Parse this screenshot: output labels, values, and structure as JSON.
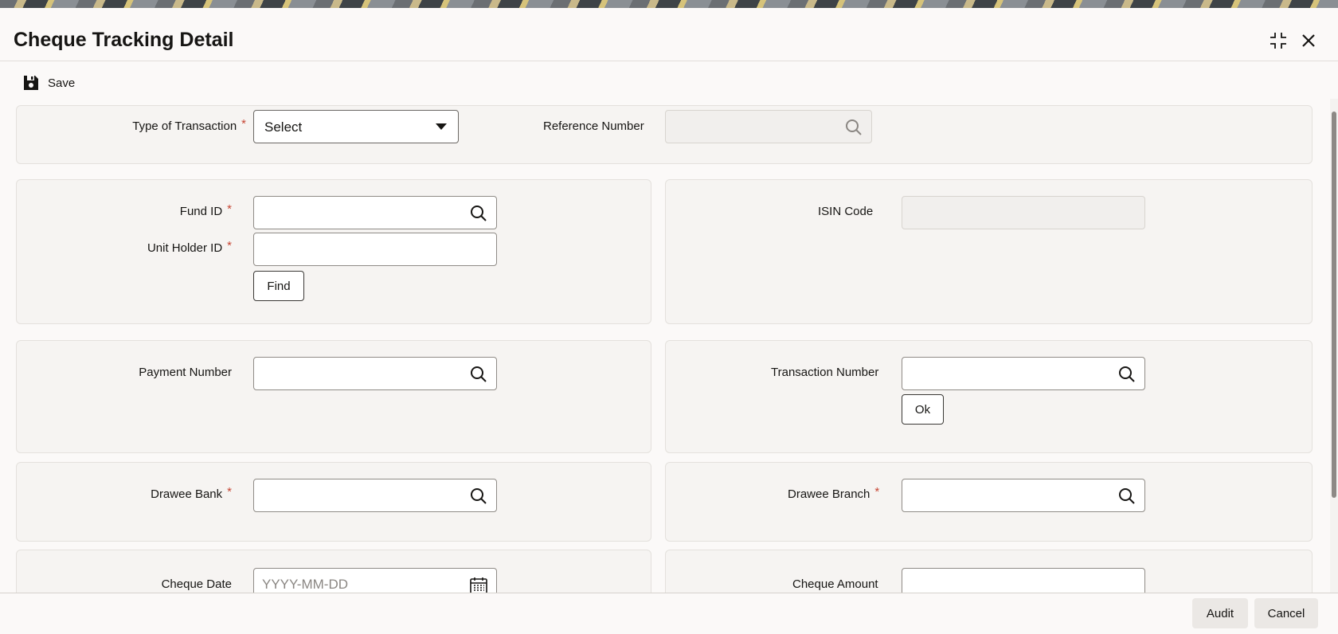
{
  "window": {
    "title": "Cheque Tracking Detail"
  },
  "toolbar": {
    "save_label": "Save"
  },
  "section_transaction": {
    "type_label": "Type of Transaction",
    "type_value": "Select",
    "reference_label": "Reference Number",
    "reference_value": ""
  },
  "section_fund": {
    "fund_id_label": "Fund ID",
    "fund_id_value": "",
    "unit_holder_label": "Unit Holder ID",
    "unit_holder_value": "",
    "find_label": "Find",
    "isin_label": "ISIN Code",
    "isin_value": ""
  },
  "section_payment": {
    "payment_label": "Payment Number",
    "payment_value": "",
    "transaction_label": "Transaction Number",
    "transaction_value": "",
    "ok_label": "Ok"
  },
  "section_drawee": {
    "bank_label": "Drawee Bank",
    "bank_value": "",
    "branch_label": "Drawee Branch",
    "branch_value": ""
  },
  "section_cheque": {
    "date_label": "Cheque Date",
    "date_placeholder": "YYYY-MM-DD",
    "amount_label": "Cheque Amount",
    "amount_value": ""
  },
  "footer": {
    "audit_label": "Audit",
    "cancel_label": "Cancel"
  },
  "required_mark": "*"
}
